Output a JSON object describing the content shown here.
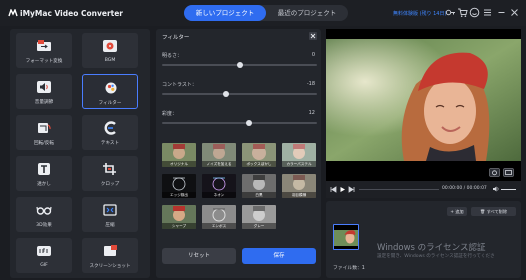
{
  "app": {
    "title": "iMyMac Video Converter",
    "tabs": [
      {
        "label": "新しいプロジェクト",
        "active": true
      },
      {
        "label": "最近のプロジェクト",
        "active": false
      }
    ],
    "trial_text": "無料体験版 (残り 14日)",
    "header_icons": [
      "key-icon",
      "cart-icon",
      "smiley-icon",
      "menu-icon",
      "minimize-icon",
      "close-icon"
    ],
    "accent_color": "#2f6cf0"
  },
  "tools": [
    {
      "label": "フォーマット変換",
      "icon": "format-convert-icon",
      "active": false
    },
    {
      "label": "BGM",
      "icon": "bgm-icon",
      "active": false
    },
    {
      "label": "音量調節",
      "icon": "volume-icon",
      "active": false
    },
    {
      "label": "フィルター",
      "icon": "filter-icon",
      "active": true
    },
    {
      "label": "回転/反転",
      "icon": "rotate-icon",
      "active": false
    },
    {
      "label": "テキスト",
      "icon": "text-icon",
      "active": false
    },
    {
      "label": "透かし",
      "icon": "watermark-icon",
      "active": false
    },
    {
      "label": "クロップ",
      "icon": "crop-icon",
      "active": false
    },
    {
      "label": "3D効果",
      "icon": "glasses-3d-icon",
      "active": false
    },
    {
      "label": "圧縮",
      "icon": "compress-icon",
      "active": false
    },
    {
      "label": "GIF",
      "icon": "gif-icon",
      "active": false
    },
    {
      "label": "スクリーンショット",
      "icon": "screenshot-icon",
      "active": false
    }
  ],
  "filter_panel": {
    "title": "フィルター",
    "sliders": [
      {
        "label": "明るさ：",
        "value": "0",
        "level": 0.5
      },
      {
        "label": "コントラスト：",
        "value": "-18",
        "level": 0.41
      },
      {
        "label": "彩度：",
        "value": "12",
        "level": 0.56
      }
    ],
    "filters": [
      "オリジナル",
      "ノイズを加える",
      "ボックスぼかし",
      "カラーパステル",
      "エッジ検出",
      "ネオン",
      "白黒",
      "羽目模様",
      "シャープ",
      "エンボス",
      "グレー",
      ""
    ],
    "reset_label": "リセット",
    "save_label": "保存"
  },
  "player": {
    "time": "00:00:00 / 00:00:07",
    "progress": 0.0
  },
  "files": {
    "add_label": "+ 追加",
    "delete_all_label": "🗑 すべて削除",
    "count_label": "ファイル数：1",
    "watermark_title": "Windows のライセンス認証",
    "watermark_sub": "設定を開き、Windows のライセンス認証を行ってくださ"
  }
}
